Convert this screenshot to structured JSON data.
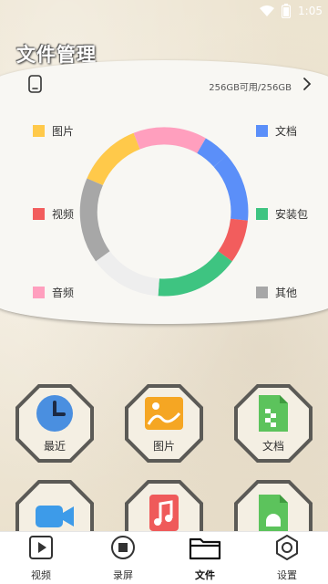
{
  "status_bar": {
    "time": "1:05"
  },
  "header": {
    "title": "文件管理"
  },
  "storage": {
    "text": "256GB可用/256GB"
  },
  "categories": [
    {
      "label": "图片",
      "color": "#ffc94a",
      "value": 1
    },
    {
      "label": "视频",
      "color": "#f25d5d",
      "value": 1
    },
    {
      "label": "音频",
      "color": "#ff9fbe",
      "value": 1
    },
    {
      "label": "文档",
      "color": "#5b8ff9",
      "value": 1
    },
    {
      "label": "安装包",
      "color": "#3ec481",
      "value": 1
    },
    {
      "label": "其他",
      "color": "#a7a7a7",
      "value": 1
    }
  ],
  "tiles": [
    {
      "label": "最近",
      "icon": "clock-icon"
    },
    {
      "label": "图片",
      "icon": "image-icon"
    },
    {
      "label": "文档",
      "icon": "document-icon"
    },
    {
      "label": "",
      "icon": "video-camera-icon"
    },
    {
      "label": "",
      "icon": "music-note-icon"
    },
    {
      "label": "",
      "icon": "android-package-icon"
    }
  ],
  "nav": [
    {
      "label": "视频",
      "icon": "play-icon"
    },
    {
      "label": "录屏",
      "icon": "record-icon"
    },
    {
      "label": "文件",
      "icon": "folder-icon",
      "active": true
    },
    {
      "label": "设置",
      "icon": "settings-icon"
    }
  ]
}
